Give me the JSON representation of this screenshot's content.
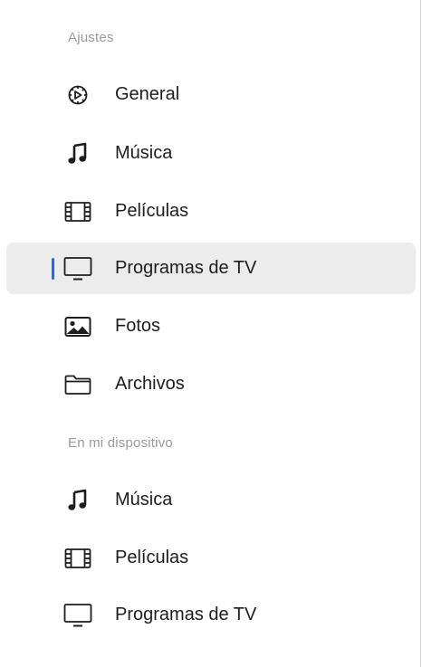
{
  "sections": [
    {
      "title": "Ajustes",
      "items": [
        {
          "label": "General",
          "icon": "gear-icon"
        },
        {
          "label": "Música",
          "icon": "music-note-icon"
        },
        {
          "label": "Películas",
          "icon": "film-icon"
        },
        {
          "label": "Programas de TV",
          "icon": "tv-icon",
          "selected": true
        },
        {
          "label": "Fotos",
          "icon": "photo-icon"
        },
        {
          "label": "Archivos",
          "icon": "folder-icon"
        }
      ]
    },
    {
      "title": "En mi dispositivo",
      "items": [
        {
          "label": "Música",
          "icon": "music-note-icon"
        },
        {
          "label": "Películas",
          "icon": "film-icon"
        },
        {
          "label": "Programas de TV",
          "icon": "tv-icon"
        }
      ]
    }
  ],
  "colors": {
    "accent": "#1a6cf0",
    "selected_bg": "#ececec",
    "section_title": "#9a9a9a"
  }
}
